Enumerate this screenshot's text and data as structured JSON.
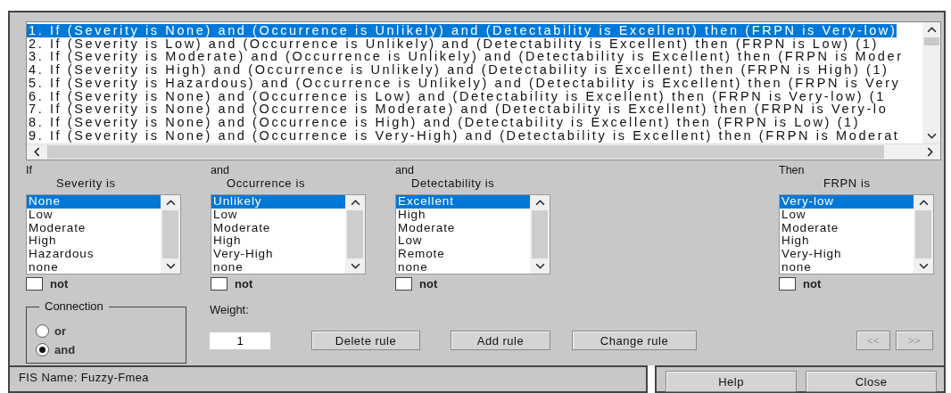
{
  "rules": [
    {
      "text": "1. If (Severity is None) and (Occurrence is Unlikely) and (Detectability is Excellent) then (FRPN is Very-low)",
      "selected": true
    },
    {
      "text": "2. If (Severity is Low) and (Occurrence is Unlikely) and (Detectability is Excellent) then (FRPN is Low) (1)",
      "selected": false
    },
    {
      "text": "3. If (Severity is Moderate) and (Occurrence is Unlikely) and (Detectability is Excellent) then (FRPN is Moder",
      "selected": false
    },
    {
      "text": "4. If (Severity is High) and (Occurrence is Unlikely) and (Detectability is Excellent) then (FRPN is High) (1)",
      "selected": false
    },
    {
      "text": "5. If (Severity is Hazardous) and (Occurrence is Unlikely) and (Detectability is Excellent) then (FRPN is Very",
      "selected": false
    },
    {
      "text": "6. If (Severity is None) and (Occurrence is Low) and (Detectability is Excellent) then (FRPN is Very-low) (1",
      "selected": false
    },
    {
      "text": "7. If (Severity is None) and (Occurrence is Moderate) and (Detectability is Excellent) then (FRPN is Very-lo",
      "selected": false
    },
    {
      "text": "8. If (Severity is None) and (Occurrence is High) and (Detectability is Excellent) then (FRPN is Low) (1)",
      "selected": false
    },
    {
      "text": "9. If (Severity is None) and (Occurrence is Very-High) and (Detectability is Excellent) then (FRPN is Moderat",
      "selected": false
    }
  ],
  "variables": [
    {
      "kind": "input",
      "prefix": "If",
      "label": "Severity is",
      "options": [
        {
          "label": "None",
          "selected": true
        },
        {
          "label": "Low",
          "selected": false
        },
        {
          "label": "Moderate",
          "selected": false
        },
        {
          "label": "High",
          "selected": false
        },
        {
          "label": "Hazardous",
          "selected": false
        },
        {
          "label": "none",
          "selected": false
        }
      ],
      "not": {
        "label": "not",
        "checked": false
      }
    },
    {
      "kind": "input",
      "prefix": "and",
      "label": "Occurrence is",
      "options": [
        {
          "label": "Unlikely",
          "selected": true
        },
        {
          "label": "Low",
          "selected": false
        },
        {
          "label": "Moderate",
          "selected": false
        },
        {
          "label": "High",
          "selected": false
        },
        {
          "label": "Very-High",
          "selected": false
        },
        {
          "label": "none",
          "selected": false
        }
      ],
      "not": {
        "label": "not",
        "checked": false
      }
    },
    {
      "kind": "input",
      "prefix": "and",
      "label": "Detectability is",
      "options": [
        {
          "label": "Excellent",
          "selected": true
        },
        {
          "label": "High",
          "selected": false
        },
        {
          "label": "Moderate",
          "selected": false
        },
        {
          "label": "Low",
          "selected": false
        },
        {
          "label": "Remote",
          "selected": false
        },
        {
          "label": "none",
          "selected": false
        }
      ],
      "not": {
        "label": "not",
        "checked": false
      }
    },
    {
      "kind": "output",
      "prefix": "Then",
      "label": "FRPN is",
      "options": [
        {
          "label": "Very-low",
          "selected": true
        },
        {
          "label": "Low",
          "selected": false
        },
        {
          "label": "Moderate",
          "selected": false
        },
        {
          "label": "High",
          "selected": false
        },
        {
          "label": "Very-High",
          "selected": false
        },
        {
          "label": "none",
          "selected": false
        }
      ],
      "not": {
        "label": "not",
        "checked": false
      }
    }
  ],
  "connection": {
    "title": "Connection",
    "options": [
      {
        "label": "or",
        "selected": false
      },
      {
        "label": "and",
        "selected": true
      }
    ]
  },
  "weight": {
    "label": "Weight:",
    "value": "1"
  },
  "buttons": [
    {
      "label": "Delete rule",
      "disabled": false
    },
    {
      "label": "Add rule",
      "disabled": false
    },
    {
      "label": "Change rule",
      "disabled": false
    }
  ],
  "nav_buttons": [
    {
      "label": "<<",
      "disabled": true
    },
    {
      "label": ">>",
      "disabled": true
    }
  ],
  "status_bar": "FIS Name: Fuzzy-Fmea",
  "footer_buttons": [
    {
      "label": "Help"
    },
    {
      "label": "Close"
    }
  ]
}
